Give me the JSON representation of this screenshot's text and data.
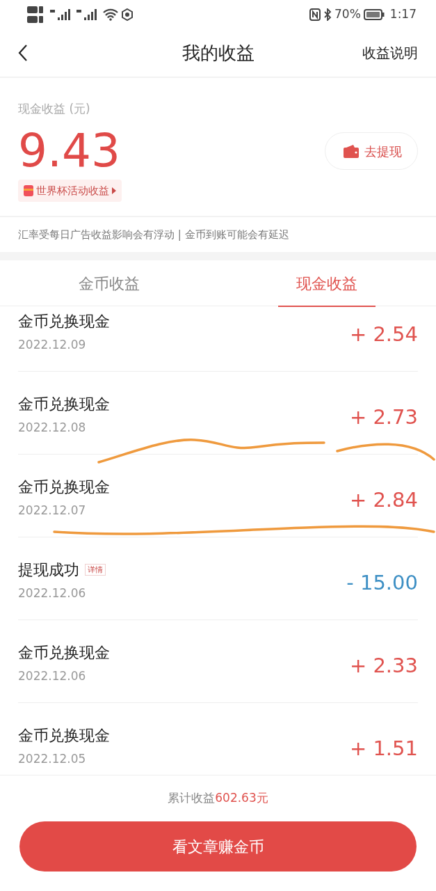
{
  "status_bar": {
    "battery": "70%",
    "time": "1:17"
  },
  "header": {
    "title": "我的收益",
    "action": "收益说明"
  },
  "summary": {
    "label": "现金收益 (元)",
    "amount": "9.43",
    "activity": "世界杯活动收益",
    "withdraw_button": "去提现"
  },
  "notice": "汇率受每日广告收益影响会有浮动 | 金币到账可能会有延迟",
  "tabs": [
    {
      "label": "金币收益",
      "selected": false
    },
    {
      "label": "现金收益",
      "selected": true
    }
  ],
  "records": [
    {
      "title": "金币兑换现金",
      "date": "2022.12.09",
      "amount": "+ 2.54",
      "kind": "income"
    },
    {
      "title": "金币兑换现金",
      "date": "2022.12.08",
      "amount": "+ 2.73",
      "kind": "income"
    },
    {
      "title": "金币兑换现金",
      "date": "2022.12.07",
      "amount": "+ 2.84",
      "kind": "income"
    },
    {
      "title": "提现成功",
      "tag": "详情",
      "date": "2022.12.06",
      "amount": "- 15.00",
      "kind": "expense"
    },
    {
      "title": "金币兑换现金",
      "date": "2022.12.06",
      "amount": "+ 2.33",
      "kind": "income"
    },
    {
      "title": "金币兑换现金",
      "date": "2022.12.05",
      "amount": "+ 1.51",
      "kind": "income"
    }
  ],
  "footer": {
    "total_label": "累计收益",
    "total_value": "602.63元",
    "button": "看文章赚金币"
  }
}
